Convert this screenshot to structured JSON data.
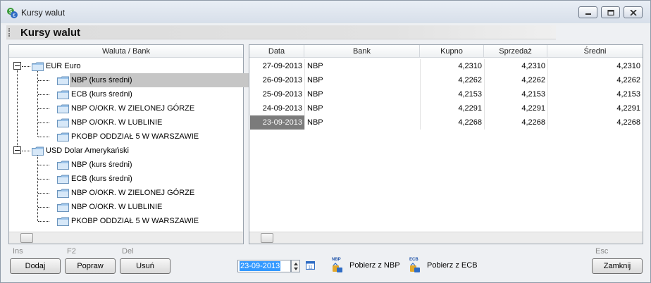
{
  "window": {
    "title": "Kursy walut",
    "header": "Kursy walut"
  },
  "tree": {
    "column_header": "Waluta / Bank",
    "groups": [
      {
        "label": "EUR Euro",
        "children": [
          "NBP (kurs średni)",
          "ECB (kurs średni)",
          "NBP  O/OKR. W ZIELONEJ GÓRZE",
          "NBP O/OKR. W LUBLINIE",
          "PKOBP ODDZIAŁ 5 W WARSZAWIE"
        ]
      },
      {
        "label": "USD Dolar Amerykański",
        "children": [
          "NBP (kurs średni)",
          "ECB (kurs średni)",
          "NBP  O/OKR. W ZIELONEJ GÓRZE",
          "NBP O/OKR. W LUBLINIE",
          "PKOBP ODDZIAŁ 5 W WARSZAWIE"
        ]
      }
    ],
    "selected": "EUR Euro / NBP (kurs średni)"
  },
  "grid": {
    "columns": [
      "Data",
      "Bank",
      "Kupno",
      "Sprzedaż",
      "Średni"
    ],
    "rows": [
      [
        "27-09-2013",
        "NBP",
        "4,2310",
        "4,2310",
        "4,2310"
      ],
      [
        "26-09-2013",
        "NBP",
        "4,2262",
        "4,2262",
        "4,2262"
      ],
      [
        "25-09-2013",
        "NBP",
        "4,2153",
        "4,2153",
        "4,2153"
      ],
      [
        "24-09-2013",
        "NBP",
        "4,2291",
        "4,2291",
        "4,2291"
      ],
      [
        "23-09-2013",
        "NBP",
        "4,2268",
        "4,2268",
        "4,2268"
      ]
    ],
    "active_row": 4
  },
  "buttons": {
    "add": {
      "key": "Ins",
      "label": "Dodaj"
    },
    "edit": {
      "key": "F2",
      "label": "Popraw"
    },
    "delete": {
      "key": "Del",
      "label": "Usuń"
    },
    "close": {
      "key": "Esc",
      "label": "Zamknij"
    }
  },
  "date_picker": {
    "value": "23-09-2013",
    "calendar_day": "11"
  },
  "actions": {
    "nbp": {
      "tag": "NBP",
      "label": "Pobierz z NBP"
    },
    "ecb": {
      "tag": "ECB",
      "label": "Pobierz z ECB"
    }
  },
  "icons": [
    "app-currency-icon",
    "minimize-icon",
    "maximize-icon",
    "close-icon",
    "collapse-icon",
    "folder-icon",
    "scroll-left-icon",
    "scroll-right-icon",
    "spin-up-icon",
    "spin-down-icon",
    "calendar-icon",
    "nbp-fetch-icon",
    "ecb-fetch-icon"
  ],
  "colors": {
    "selection_tree": "#c6c6c6",
    "selection_grid": "#7b7b7b",
    "date_highlight": "#3399ff",
    "folder": "#9cc4ea"
  }
}
